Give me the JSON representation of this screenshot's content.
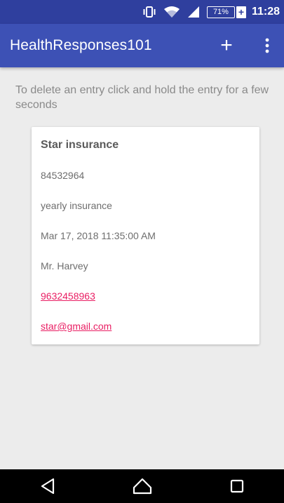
{
  "status_bar": {
    "battery_percent": "71%",
    "battery_plus": "+",
    "time": "11:28",
    "icons": [
      "vibrate-icon",
      "wifi-icon",
      "signal-icon"
    ]
  },
  "app_bar": {
    "title": "HealthResponses101",
    "add_label": "+",
    "overflow_icon": "overflow-menu-icon"
  },
  "hint": "To delete an entry click and hold the entry for a few seconds",
  "entry": {
    "name": "Star insurance",
    "policy_number": "84532964",
    "type": "yearly insurance",
    "date": "Mar 17, 2018 11:35:00 AM",
    "contact": "Mr. Harvey",
    "phone": "9632458963",
    "email": "star@gmail.com"
  },
  "nav_bar": {
    "icons": [
      "back-icon",
      "home-icon",
      "recents-icon"
    ]
  },
  "colors": {
    "status_bar": "#2f3f9e",
    "app_bar": "#3d51b5",
    "link": "#e91e63",
    "background": "#ececec"
  }
}
